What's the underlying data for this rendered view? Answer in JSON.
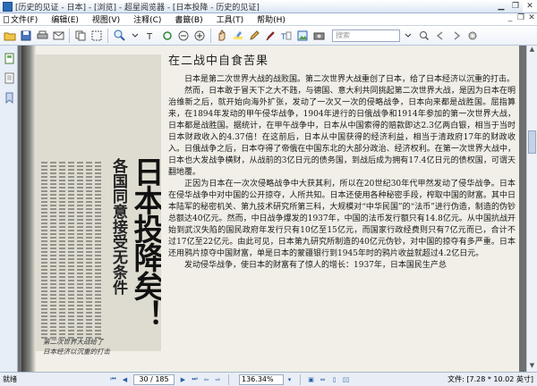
{
  "window": {
    "title": "[历史的见证 - 日本] - [浏览] - 超星阅览器 - [日本投降 - 历史的见证]"
  },
  "menu": {
    "items": [
      "文件(F)",
      "编辑(E)",
      "视图(V)",
      "注释(C)",
      "書籤(B)",
      "工具(T)",
      "帮助(H)"
    ]
  },
  "toolbar": {
    "search_placeholder": "搜索"
  },
  "page": {
    "heading": "在二战中自食苦果",
    "paragraphs": [
      "日本是第二次世界大战的战败国。第二次世界大战重创了日本，给了日本经济以沉重的打击。",
      "然而，日本敢于冒天下之大不韪，与德国、意大利共同挑起第二次世界大战，是因为日本在明治维新之后，就开始向海外扩张，发动了一次又一次的侵略战争，日本向来都是战胜国。屈指算来，在1894年发动的甲午侵华战争，1904年进行的日俄战争和1914年参加的第一次世界大战，日本都是战胜国。据统计，在甲午战争中，日本从中国索得的赔款即达2.3亿两白银，相当于当时日本财政收入的4.37倍！在这前后，日本从中国获得的经济利益，相当于清政府17年的财政收入。日俄战争之后，日本夺得了帝俄在中国东北的大部分政治、经济权利。在第一次世界大战中，日本也大发战争横财，从战前的3亿日元的债务国，到战后成为拥有17.4亿日元的债权国，可谓天翻地覆。",
      "正因为日本在一次次侵略战争中大获其利，所以在20世纪30年代甲然发动了侵华战争。日本在侵华战争中对中国的公开掠夺，人所共知。日本还使用各种秘密手段，榨取中国的财富。其中日本陆军的秘密机关、第九技术研究所第三科，大规模对“中华民国”的“法币”进行伪造，制造的伪钞总额达40亿元。然而，中日战争爆发的1937年，中国的法币发行额只有14.8亿元。从中国抗战开始到武汉失陷的国民政府年发行只有10亿至15亿元，而国家行政经费则只有7亿元而已，合计不过17亿至22亿元。由此可见，日本第九研究所制造的40亿元伪钞，对中国的掠夺有多严重。日本还用鸦片掠夺中国财富，单是日本的蒙疆银行到1945年时的鸦片收益就超过4.2亿日元。",
      "发动侵华战争，使日本的财富有了惊人的增长：1937年，日本国民生产总"
    ],
    "newspaper_headline": "日本投降矣！",
    "newspaper_subhead": "各国同意接受无条件",
    "caption_line1": "第二次世界大战给了",
    "caption_line2": "日本经济以沉重的打击"
  },
  "status": {
    "left_text": "就绪",
    "page_indicator": "30 / 185",
    "zoom": "136.34%",
    "doc_size": "文件: [7.28 * 10.02 英寸]"
  }
}
